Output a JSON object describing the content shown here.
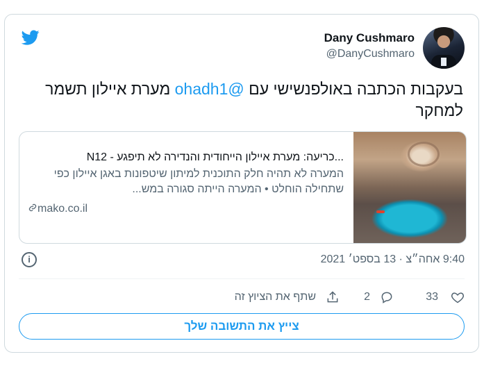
{
  "author": {
    "name": "Dany Cushmaro",
    "handle": "@DanyCushmaro"
  },
  "tweet": {
    "text_before_mention": "בעקבות הכתבה באולפנשישי עם ",
    "mention": "@ohadh1",
    "text_after_mention": "  מערת איילון תשמר למחקר"
  },
  "link_card": {
    "title": "...כריעה: מערת איילון הייחודית והנדירה לא תיפגע - N12",
    "description": "המערה לא תהיה חלק התוכנית למיתון שיטפונות באגן איילון כפי שתחילה הוחלט • המערה הייתה סגורה במש...",
    "domain": "mako.co.il"
  },
  "meta": {
    "timestamp": "9:40 אחה״צ · 13 בספט׳ 2021"
  },
  "actions": {
    "like_count": "33",
    "reply_count": "2",
    "share_label": "שתף את הציוץ זה"
  },
  "reply_button": {
    "label": "צייץ את התשובה שלך"
  },
  "colors": {
    "accent": "#1d9bf0",
    "secondary_text": "#536471",
    "border": "#cfd9de"
  },
  "icons": [
    "twitter-bird-icon",
    "link-icon",
    "info-icon",
    "heart-icon",
    "reply-icon",
    "share-icon"
  ]
}
